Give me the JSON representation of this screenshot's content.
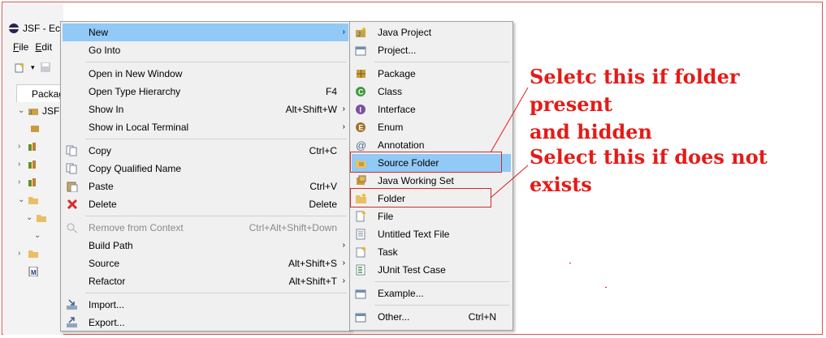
{
  "ide": {
    "title": "JSF - Ec",
    "menu": [
      "File",
      "Edit"
    ],
    "tab": "Packag",
    "project": "JSFI"
  },
  "menu1": {
    "items": [
      {
        "label": "New",
        "shortcut": "",
        "submenu": true,
        "icon": "none",
        "highlight": true
      },
      {
        "label": "Go Into",
        "shortcut": "",
        "submenu": false
      },
      {
        "label": "Open in New Window",
        "shortcut": "",
        "submenu": false
      },
      {
        "label": "Open Type Hierarchy",
        "shortcut": "F4",
        "submenu": false
      },
      {
        "label": "Show In",
        "shortcut": "Alt+Shift+W",
        "submenu": true
      },
      {
        "label": "Show in Local Terminal",
        "shortcut": "",
        "submenu": true
      },
      {
        "label": "Copy",
        "shortcut": "Ctrl+C",
        "icon": "copy-icon"
      },
      {
        "label": "Copy Qualified Name",
        "shortcut": "",
        "icon": "copy-qualified-icon"
      },
      {
        "label": "Paste",
        "shortcut": "Ctrl+V",
        "icon": "paste-icon"
      },
      {
        "label": "Delete",
        "shortcut": "Delete",
        "icon": "delete-icon"
      },
      {
        "label": "Remove from Context",
        "shortcut": "Ctrl+Alt+Shift+Down",
        "disabled": true,
        "icon": "remove-context-icon"
      },
      {
        "label": "Build Path",
        "shortcut": "",
        "submenu": true
      },
      {
        "label": "Source",
        "shortcut": "Alt+Shift+S",
        "submenu": true
      },
      {
        "label": "Refactor",
        "shortcut": "Alt+Shift+T",
        "submenu": true
      },
      {
        "label": "Import...",
        "shortcut": "",
        "icon": "import-icon"
      },
      {
        "label": "Export...",
        "shortcut": "",
        "icon": "export-icon"
      }
    ]
  },
  "menu2": {
    "items": [
      {
        "label": "Java Project",
        "icon": "java-project-icon"
      },
      {
        "label": "Project...",
        "icon": "project-icon"
      },
      {
        "label": "Package",
        "icon": "package-icon"
      },
      {
        "label": "Class",
        "icon": "class-icon"
      },
      {
        "label": "Interface",
        "icon": "interface-icon"
      },
      {
        "label": "Enum",
        "icon": "enum-icon"
      },
      {
        "label": "Annotation",
        "icon": "annotation-icon"
      },
      {
        "label": "Source Folder",
        "icon": "source-folder-icon",
        "highlight": true
      },
      {
        "label": "Java Working Set",
        "icon": "working-set-icon"
      },
      {
        "label": "Folder",
        "icon": "folder-icon"
      },
      {
        "label": "File",
        "icon": "file-icon"
      },
      {
        "label": "Untitled Text File",
        "icon": "text-file-icon"
      },
      {
        "label": "Task",
        "icon": "task-icon"
      },
      {
        "label": "JUnit Test Case",
        "icon": "junit-icon"
      },
      {
        "label": "Example...",
        "icon": "example-icon"
      },
      {
        "label": "Other...",
        "shortcut": "Ctrl+N",
        "icon": "other-icon"
      }
    ]
  },
  "annotations": {
    "hidden_note_line1": "Seletc this if folder present",
    "hidden_note_line2": "and hidden",
    "missing_note_line1": "Select this if does not",
    "missing_note_line2": "exists"
  },
  "colors": {
    "highlight": "#91c9f7",
    "annotation": "#e41b17",
    "menu_bg": "#f0f0f0"
  }
}
